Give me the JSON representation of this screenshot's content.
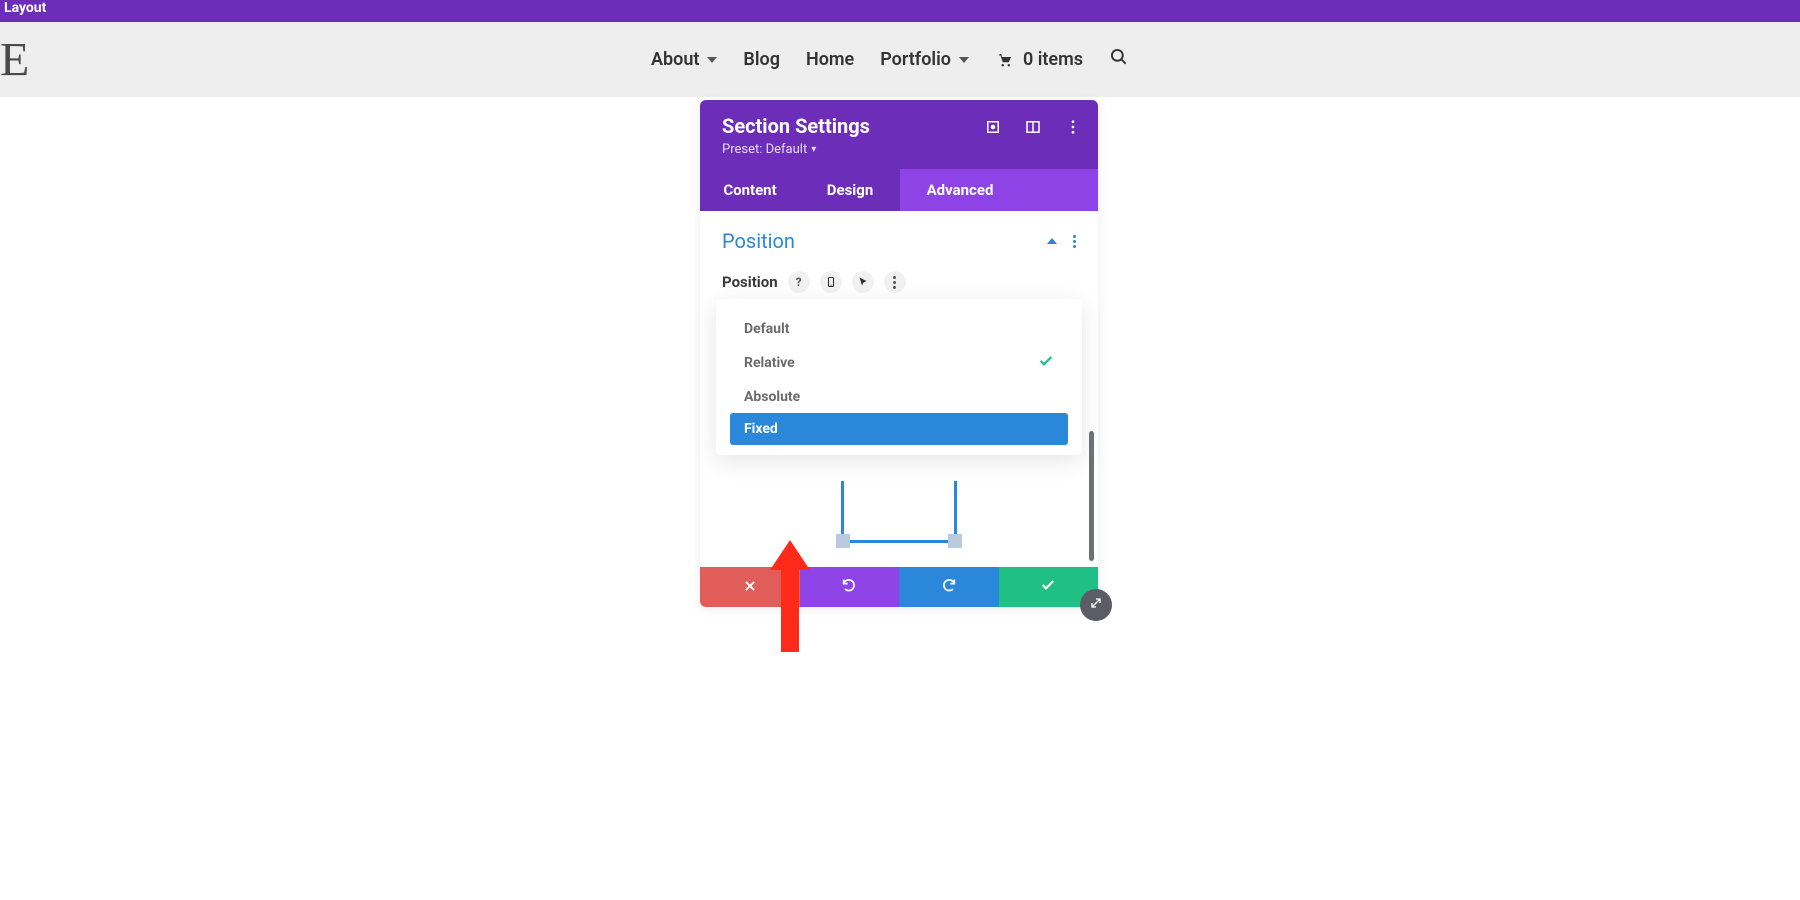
{
  "topbar": {
    "label": "Layout"
  },
  "nav": {
    "items": {
      "about": "About",
      "blog": "Blog",
      "home": "Home",
      "portfolio": "Portfolio",
      "cart": "0 items"
    }
  },
  "panel": {
    "title": "Section Settings",
    "preset_label": "Preset: Default",
    "tabs": {
      "content": "Content",
      "design": "Design",
      "advanced": "Advanced"
    },
    "section": {
      "title": "Position",
      "field_label": "Position"
    },
    "dropdown": {
      "options": [
        {
          "label": "Default"
        },
        {
          "label": "Relative"
        },
        {
          "label": "Absolute"
        },
        {
          "label": "Fixed"
        }
      ],
      "selected_index": 1,
      "hover_index": 3
    }
  }
}
